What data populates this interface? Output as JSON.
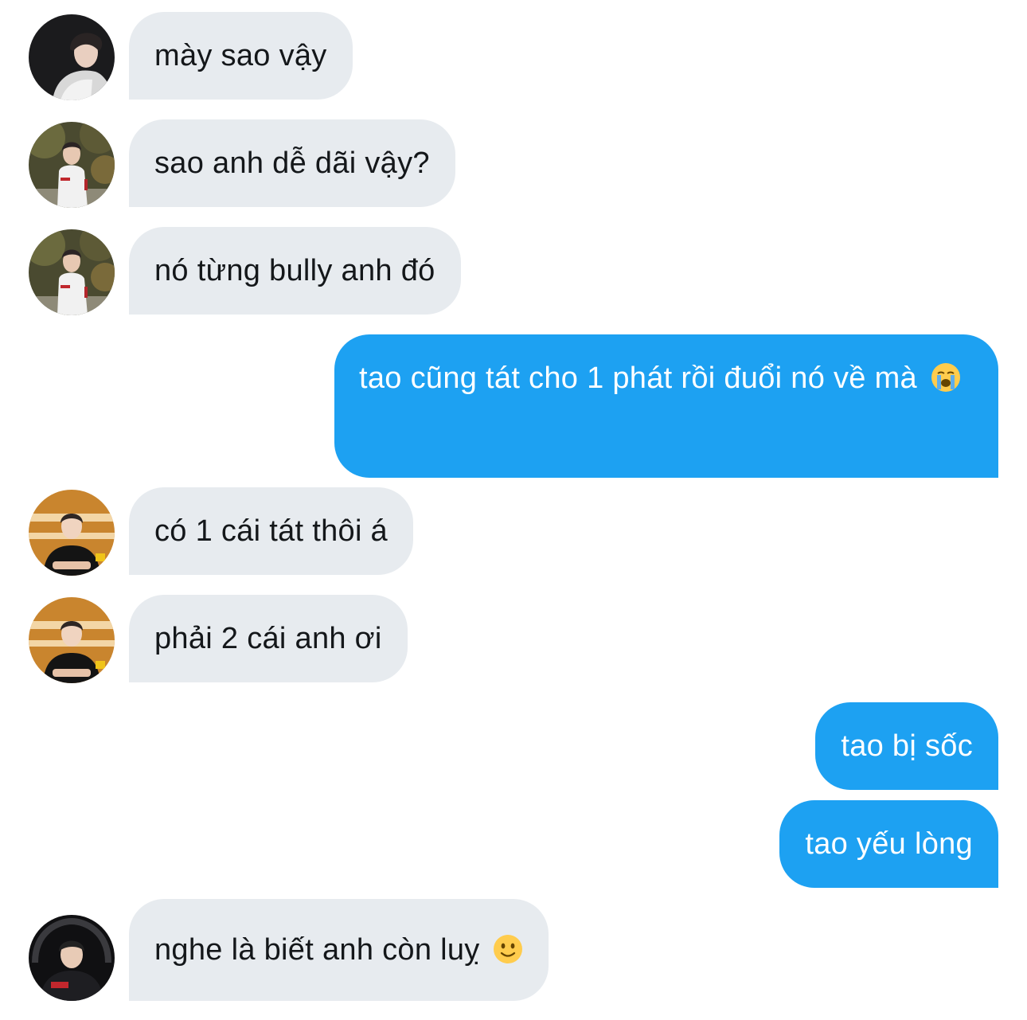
{
  "conversation": {
    "messages": [
      {
        "text": "mày sao vậy",
        "emoji": ""
      },
      {
        "text": "sao anh dễ dãi vậy?",
        "emoji": ""
      },
      {
        "text": "nó từng bully anh đó",
        "emoji": ""
      },
      {
        "text": "tao cũng tát cho 1 phát rồi đuổi nó về mà",
        "emoji": "loudly-crying-face-emoji"
      },
      {
        "text": "có 1 cái tát thôi á",
        "emoji": ""
      },
      {
        "text": "phải 2 cái anh ơi",
        "emoji": ""
      },
      {
        "text": "tao bị sốc",
        "emoji": ""
      },
      {
        "text": "tao yếu lòng",
        "emoji": ""
      },
      {
        "text": "nghe là biết anh còn luỵ",
        "emoji": "slightly-smiling-face-emoji"
      }
    ]
  },
  "colors": {
    "incoming_bubble": "#e7ebef",
    "outgoing_bubble": "#1da1f2",
    "incoming_text": "#14171a",
    "outgoing_text": "#ffffff"
  }
}
